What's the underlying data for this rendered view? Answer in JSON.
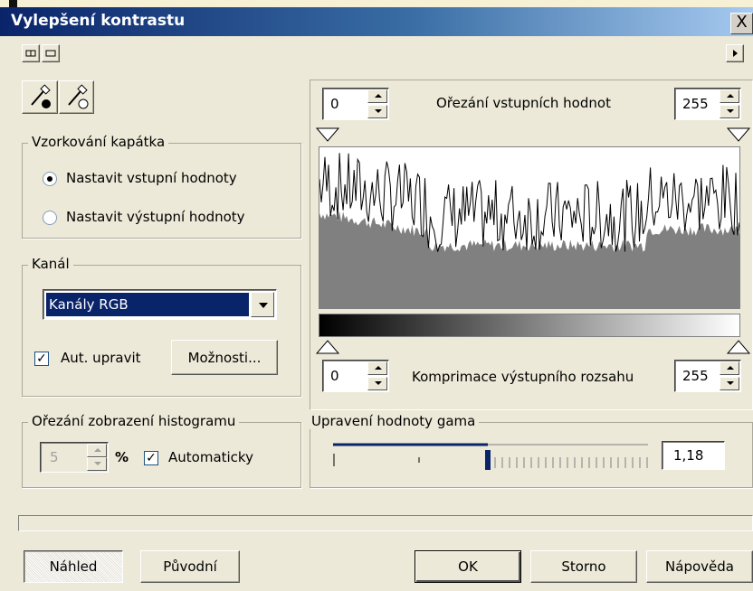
{
  "window": {
    "title": "Vylepšení kontrastu",
    "close_label": "X"
  },
  "eyedropper_group": {
    "legend": "Vzorkování kapátka",
    "options": [
      "Nastavit vstupní hodnoty",
      "Nastavit výstupní hodnoty"
    ],
    "selected": "Nastavit vstupní hodnoty"
  },
  "channel_group": {
    "legend": "Kanál",
    "selected_channel": "Kanály RGB",
    "auto_adjust_label": "Aut. upravit",
    "auto_adjust_checked": true,
    "options_button": "Možnosti..."
  },
  "histogram_clip_group": {
    "legend": "Ořezání zobrazení histogramu",
    "value": "5",
    "unit": "%",
    "automatic_label": "Automaticky",
    "automatic_checked": true
  },
  "input_clip": {
    "label": "Ořezání vstupních hodnot",
    "low": "0",
    "high": "255"
  },
  "output_range": {
    "label": "Komprimace výstupního rozsahu",
    "low": "0",
    "high": "255"
  },
  "gamma_group": {
    "legend": "Upravení hodnoty gama",
    "value": "1,18",
    "slider_fraction": 0.49
  },
  "buttons": {
    "preview": "Náhled",
    "original": "Původní",
    "ok": "OK",
    "cancel": "Storno",
    "help": "Nápověda"
  },
  "colors": {
    "title_start": "#0a246a",
    "title_end": "#a6caf0",
    "selection": "#0a246a",
    "face": "#ece9d8"
  },
  "icons": {
    "view_split": "split-view-icon",
    "view_single": "single-view-icon",
    "arrow_right": "arrow-right-icon",
    "eyedropper_black": "eyedropper-black-icon",
    "eyedropper_white": "eyedropper-white-icon"
  }
}
